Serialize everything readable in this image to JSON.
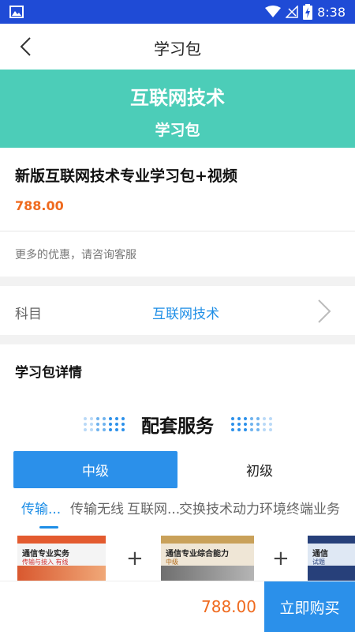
{
  "status_bar": {
    "time": "8:38",
    "icons": [
      "image-icon",
      "wifi-icon",
      "no-signal-icon",
      "battery-charging-icon"
    ]
  },
  "nav": {
    "title": "学习包",
    "back_icon": "chevron-left-icon"
  },
  "banner": {
    "title": "互联网技术",
    "subtitle": "学习包",
    "color": "#4ccdb8"
  },
  "product": {
    "name": "新版互联网技术专业学习包+视频",
    "price": "788.00",
    "discount_note": "更多的优惠，请咨询客服"
  },
  "subject": {
    "label": "科目",
    "value": "互联网技术",
    "chevron_icon": "chevron-right-icon"
  },
  "detail": {
    "title": "学习包详情",
    "service_title": "配套服务"
  },
  "level_tabs": [
    {
      "label": "中级",
      "active": true
    },
    {
      "label": "初级",
      "active": false
    }
  ],
  "subject_tabs": [
    {
      "label": "传输...",
      "active": true
    },
    {
      "label": "传输无线",
      "active": false
    },
    {
      "label": "互联网...",
      "active": false
    },
    {
      "label": "交换技术",
      "active": false
    },
    {
      "label": "动力环境",
      "active": false
    },
    {
      "label": "终端业务",
      "active": false
    }
  ],
  "books": [
    {
      "title": "通信专业实务",
      "subtitle": "传输与接入 有线"
    },
    {
      "title": "通信专业综合能力",
      "subtitle": "中级"
    },
    {
      "title": "通信",
      "subtitle": "试题"
    }
  ],
  "bottom": {
    "price": "788.00",
    "buy_label": "立即购买"
  },
  "colors": {
    "accent_blue": "#2b90ea",
    "price_orange": "#ef6a1e",
    "status_blue": "#1f4bd6"
  }
}
